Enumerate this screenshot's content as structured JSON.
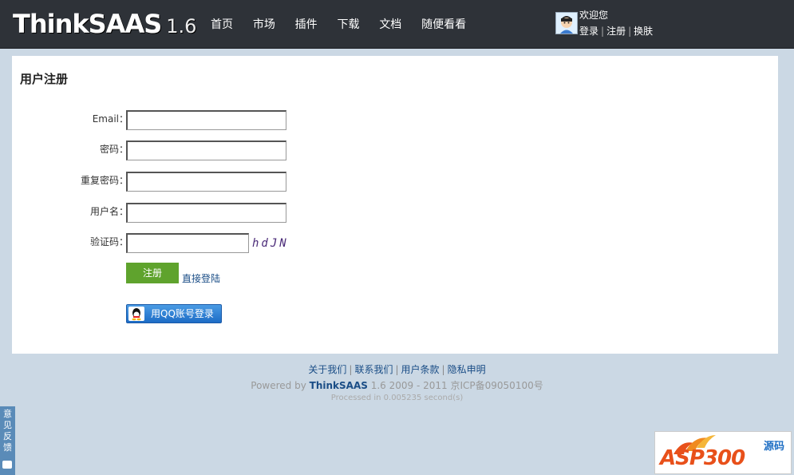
{
  "header": {
    "logo_text": "ThinkSAAS",
    "logo_version": "1.6",
    "nav": [
      "首页",
      "市场",
      "插件",
      "下载",
      "文档",
      "随便看看"
    ],
    "welcome": "欢迎您",
    "user_links": {
      "login": "登录",
      "register": "注册",
      "skin": "换肤",
      "sep": "|"
    }
  },
  "form": {
    "title": "用户注册",
    "fields": [
      {
        "label": "Email：",
        "value": ""
      },
      {
        "label": "密码：",
        "value": ""
      },
      {
        "label": "重复密码：",
        "value": ""
      },
      {
        "label": "用户名：",
        "value": ""
      },
      {
        "label": "验证码：",
        "value": ""
      }
    ],
    "captcha_text": "hdJN",
    "submit_label": "注册",
    "direct_login": "直接登陆",
    "qq_login": "用QQ账号登录"
  },
  "footer": {
    "links": [
      "关于我们",
      "联系我们",
      "用户条款",
      "隐私申明"
    ],
    "sep": "|",
    "powered_prefix": "Powered by",
    "powered_brand": "ThinkSAAS",
    "powered_suffix": "1.6 2009 - 2011 京ICP备09050100号",
    "processed": "Processed in 0.005235 second(s)"
  },
  "feedback_label": "意见反馈",
  "watermark": {
    "main": "ASP300",
    "sub": "源码"
  },
  "colors": {
    "header_bg": "#2e3238",
    "page_bg": "#cbd8e4",
    "submit_bg": "#5fa32d",
    "link": "#1a4d86",
    "qq_btn": "#1d6cc6"
  }
}
